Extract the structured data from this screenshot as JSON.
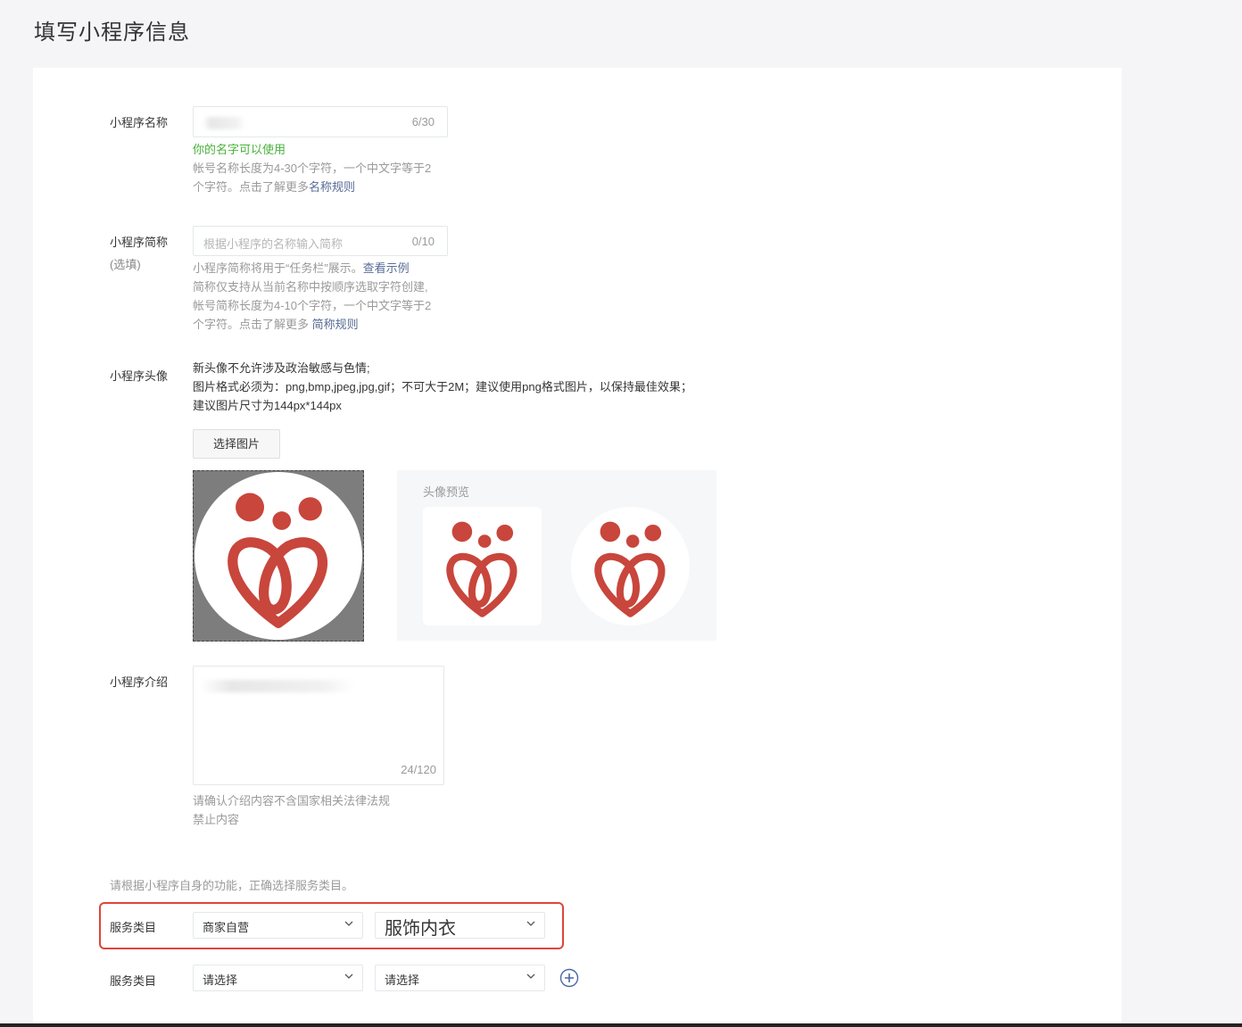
{
  "page": {
    "title": "填写小程序信息"
  },
  "name_field": {
    "label": "小程序名称",
    "counter": "6/30",
    "status": "你的名字可以使用",
    "hint_line1": "帐号名称长度为4-30个字符，一个中文字等于2",
    "hint_line2": "个字符。点击了解更多",
    "hint_link": "名称规则"
  },
  "short_name_field": {
    "label": "小程序简称",
    "optional": "(选填)",
    "placeholder": "根据小程序的名称输入简称",
    "counter": "0/10",
    "hint_line1": "小程序简称将用于“任务栏”展示。",
    "hint_link1": "查看示例",
    "hint_line2": "简称仅支持从当前名称中按顺序选取字符创建,",
    "hint_line3": "帐号简称长度为4-10个字符，一个中文字等于2",
    "hint_line4": "个字符。点击了解更多 ",
    "hint_link2": "简称规则"
  },
  "avatar_field": {
    "label": "小程序头像",
    "rule1": "新头像不允许涉及政治敏感与色情;",
    "rule2": "图片格式必须为：png,bmp,jpeg,jpg,gif；不可大于2M；建议使用png格式图片，以保持最佳效果；",
    "rule3": "建议图片尺寸为144px*144px",
    "choose_button": "选择图片",
    "preview_title": "头像预览",
    "logo_color": "#c8463c"
  },
  "intro_field": {
    "label": "小程序介绍",
    "counter": "24/120",
    "hint_line1": "请确认介绍内容不含国家相关法律法规",
    "hint_line2": "禁止内容"
  },
  "category": {
    "notice": "请根据小程序自身的功能，正确选择服务类目。",
    "rows": [
      {
        "label": "服务类目",
        "first": "商家自营",
        "second": "服饰内衣"
      },
      {
        "label": "服务类目",
        "first": "请选择",
        "second": "请选择"
      }
    ],
    "highlight_color": "#e0453a"
  },
  "colors": {
    "link": "#576b95",
    "success": "#48b23a",
    "add_icon": "#4a67a8"
  }
}
